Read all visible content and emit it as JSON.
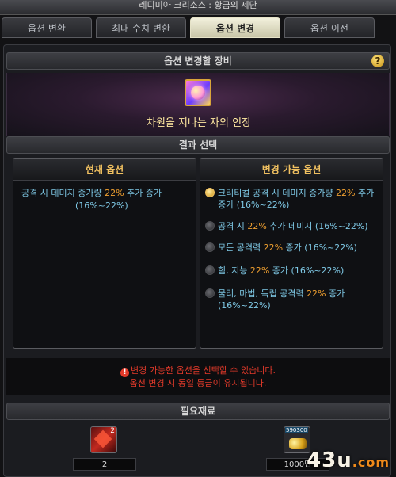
{
  "window": {
    "title": "레디미아 크리소스 : 황금의 제단"
  },
  "tabs": [
    {
      "label": "옵션 변환",
      "active": false
    },
    {
      "label": "최대 수치 변환",
      "active": false
    },
    {
      "label": "옵션 변경",
      "active": true
    },
    {
      "label": "옵션 이전",
      "active": false
    }
  ],
  "equip_section": {
    "title": "옵션 변경할 장비",
    "help_symbol": "?",
    "item_name": "차원을 지나는 자의 인장"
  },
  "result_section": {
    "title": "결과 선택"
  },
  "current_option": {
    "header": "현재 옵션",
    "text_pre": "공격 시 데미지 증가량 ",
    "value": "22%",
    "text_post": " 추가 증가",
    "range": "(16%~22%)"
  },
  "available_options": {
    "header": "변경 가능 옵션",
    "items": [
      {
        "pre": "크리티컬 공격 시 데미지 증가량 ",
        "value": "22%",
        "post": " 추가 증가 (16%~22%)",
        "selected": true
      },
      {
        "pre": "공격 시 ",
        "value": "22%",
        "post": " 추가 데미지 (16%~22%)",
        "selected": false
      },
      {
        "pre": "모든 공격력 ",
        "value": "22%",
        "post": " 증가 (16%~22%)",
        "selected": false
      },
      {
        "pre": "힘, 지능 ",
        "value": "22%",
        "post": " 증가 (16%~22%)",
        "selected": false
      },
      {
        "pre": "물리, 마법, 독립 공격력 ",
        "value": "22%",
        "post": " 증가 (16%~22%)",
        "selected": false
      }
    ]
  },
  "notice": {
    "icon_symbol": "!",
    "line1": "변경 가능한 옵션을 선택할 수 있습니다.",
    "line2": "옵션 변경 시 동일 등급이 유지됩니다."
  },
  "materials": {
    "title": "필요재료",
    "items": [
      {
        "icon": "crimson-essence-icon",
        "badge": "2",
        "count": "2"
      },
      {
        "icon": "gold-coins-icon",
        "badge": "590300",
        "count": "1000만"
      }
    ]
  },
  "watermark": {
    "main": "43u",
    "accent": ".com"
  }
}
